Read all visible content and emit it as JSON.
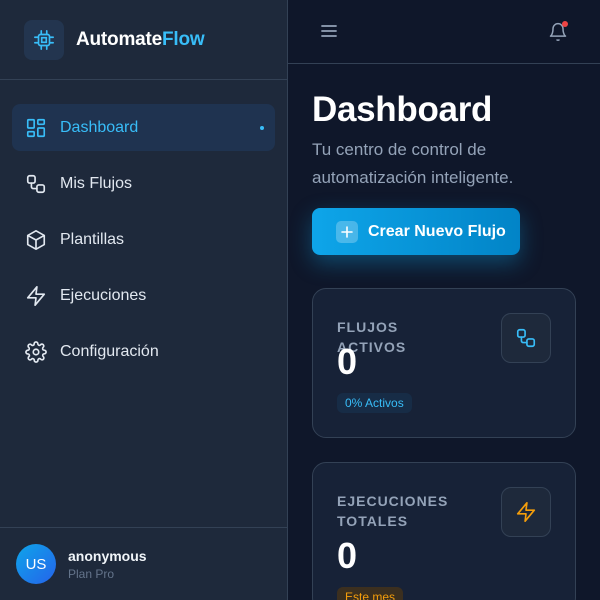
{
  "brand": {
    "name_part1": "Automate",
    "name_part2": "Flow"
  },
  "nav": {
    "items": [
      {
        "label": "Dashboard",
        "icon": "grid-icon",
        "active": true
      },
      {
        "label": "Mis Flujos",
        "icon": "workflow-icon"
      },
      {
        "label": "Plantillas",
        "icon": "cube-icon"
      },
      {
        "label": "Ejecuciones",
        "icon": "bolt-icon"
      },
      {
        "label": "Configuración",
        "icon": "gear-icon"
      }
    ]
  },
  "user": {
    "initials": "US",
    "name": "anonymous",
    "plan": "Plan Pro"
  },
  "header": {
    "menu_icon": "menu-icon",
    "bell_icon": "bell-icon"
  },
  "main": {
    "title": "Dashboard",
    "subtitle": "Tu centro de control de automatización inteligente.",
    "cta_label": "Crear Nuevo Flujo"
  },
  "cards": [
    {
      "label": "FLUJOS ACTIVOS",
      "value": "0",
      "badge": "0% Activos",
      "icon": "workflow-icon"
    },
    {
      "label": "EJECUCIONES TOTALES",
      "value": "0",
      "badge": "Este mes",
      "icon": "bolt-icon"
    }
  ],
  "colors": {
    "accent": "#38bdf8",
    "background": "#0f172a",
    "sidebar": "#1e293b",
    "warning": "#f59e0b",
    "notification": "#ef4444"
  }
}
